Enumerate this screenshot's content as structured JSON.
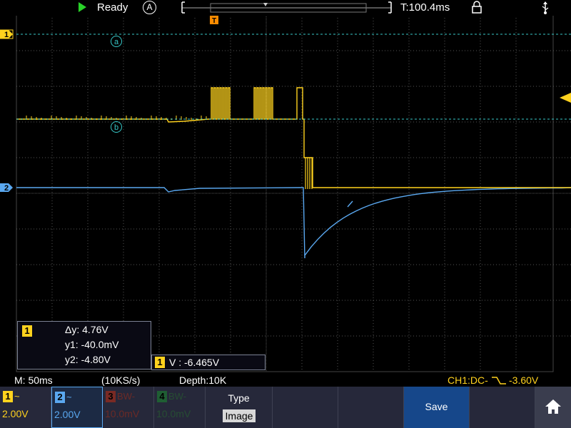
{
  "topbar": {
    "status": "Ready",
    "auto_label": "A",
    "time": "T:100.4ms",
    "trigger_marker": "T"
  },
  "markers": {
    "ch1": "1",
    "ch2": "2",
    "cursor_a": "a",
    "cursor_b": "b"
  },
  "statusline": {
    "timebase": "M: 50ms",
    "sample_rate": "(10KS/s)",
    "depth": "Depth:10K",
    "trigger": "CH1:DC-",
    "trigger_level": "-3.60V"
  },
  "cursor_panel": {
    "channel": "1",
    "dy": "Δy: 4.76V",
    "y1": "y1: -40.0mV",
    "y2": "y2: -4.80V"
  },
  "measure_panel": {
    "channel": "1",
    "text": "V : -6.465V"
  },
  "menu": {
    "ch1": {
      "num": "1",
      "coupling": "~",
      "scale": "2.00V"
    },
    "ch2": {
      "num": "2",
      "coupling": "~",
      "scale": "2.00V"
    },
    "ch3": {
      "num": "3",
      "coupling": "BW-",
      "scale": "10.0mV"
    },
    "ch4": {
      "num": "4",
      "coupling": "BW-",
      "scale": "10.0mV"
    },
    "type_label": "Type",
    "type_value": "Image",
    "save_label": "Save"
  },
  "colors": {
    "ch1": "#ffd21e",
    "ch2": "#5aa8f0",
    "ch3": "#c0392b",
    "ch4": "#27ae60",
    "cursor": "#37c8c8",
    "trigger": "#ff8c00",
    "run": "#28d228"
  },
  "icons": {
    "run": "play-icon",
    "lock": "lock-icon",
    "usb": "usb-icon",
    "home": "home-icon"
  }
}
